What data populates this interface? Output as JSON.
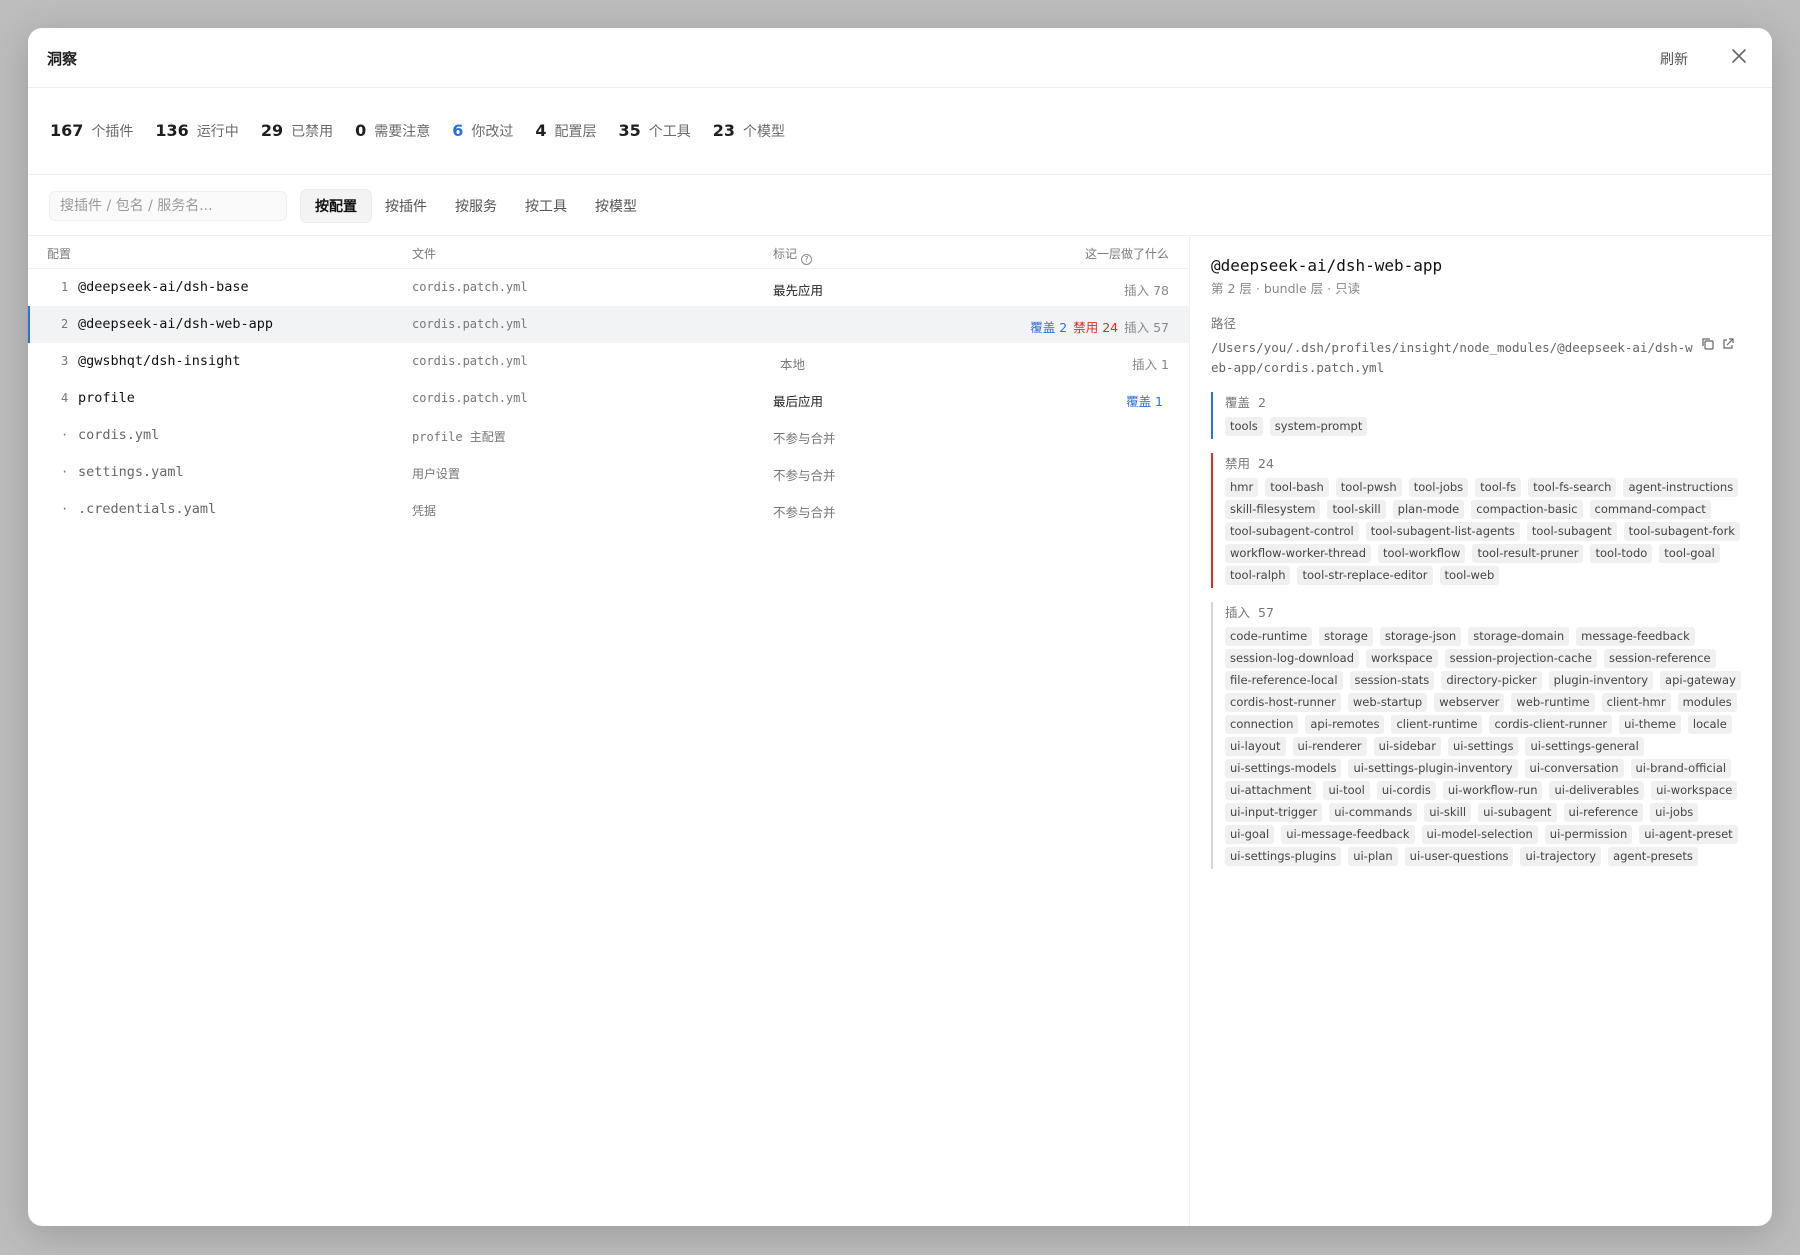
{
  "header": {
    "title": "洞察",
    "refresh": "刷新"
  },
  "stats": [
    {
      "num": "167",
      "label": "个插件"
    },
    {
      "num": "136",
      "label": "运行中"
    },
    {
      "num": "29",
      "label": "已禁用"
    },
    {
      "num": "0",
      "label": "需要注意"
    },
    {
      "num": "6",
      "label": "你改过"
    },
    {
      "num": "4",
      "label": "配置层"
    },
    {
      "num": "35",
      "label": "个工具"
    },
    {
      "num": "23",
      "label": "个模型"
    }
  ],
  "search": {
    "placeholder": "搜插件 / 包名 / 服务名..."
  },
  "tabs": [
    "按配置",
    "按插件",
    "按服务",
    "按工具",
    "按模型"
  ],
  "table": {
    "columns": {
      "config": "配置",
      "file": "文件",
      "mark": "标记",
      "what": "这一层做了什么"
    },
    "rows": [
      {
        "idx": "1",
        "name": "@deepseek-ai/dsh-base",
        "file": "cordis.patch.yml",
        "mark": "最先应用",
        "what": "插入 78"
      },
      {
        "idx": "2",
        "name": "@deepseek-ai/dsh-web-app",
        "file": "cordis.patch.yml",
        "mark": "",
        "ov": "覆盖 2",
        "dis": "禁用 24",
        "what": "插入 57"
      },
      {
        "idx": "3",
        "name": "@gwsbhqt/dsh-insight",
        "file": "cordis.patch.yml",
        "mark": "本地",
        "what": "插入 1"
      },
      {
        "idx": "4",
        "name": "profile",
        "file": "cordis.patch.yml",
        "mark": "最后应用",
        "ov": "覆盖 1"
      },
      {
        "idx": "·",
        "name": "cordis.yml",
        "file": "profile 主配置",
        "mark": "不参与合并"
      },
      {
        "idx": "·",
        "name": "settings.yaml",
        "file": "用户设置",
        "mark": "不参与合并"
      },
      {
        "idx": "·",
        "name": ".credentials.yaml",
        "file": "凭据",
        "mark": "不参与合并"
      }
    ]
  },
  "detail": {
    "title": "@deepseek-ai/dsh-web-app",
    "subtitle": "第 2 层 · bundle 层 · 只读",
    "path_label": "路径",
    "path": "/Users/you/.dsh/profiles/insight/node_modules/@deepseek-ai/dsh-web-app/cordis.patch.yml",
    "override": {
      "label": "覆盖",
      "count": "2",
      "items": [
        "tools",
        "system-prompt"
      ]
    },
    "disabled": {
      "label": "禁用",
      "count": "24",
      "items": [
        "hmr",
        "tool-bash",
        "tool-pwsh",
        "tool-jobs",
        "tool-fs",
        "tool-fs-search",
        "agent-instructions",
        "skill-filesystem",
        "tool-skill",
        "plan-mode",
        "compaction-basic",
        "command-compact",
        "tool-subagent-control",
        "tool-subagent-list-agents",
        "tool-subagent",
        "tool-subagent-fork",
        "workflow-worker-thread",
        "tool-workflow",
        "tool-result-pruner",
        "tool-todo",
        "tool-goal",
        "tool-ralph",
        "tool-str-replace-editor",
        "tool-web"
      ]
    },
    "inserted": {
      "label": "插入",
      "count": "57",
      "items": [
        "code-runtime",
        "storage",
        "storage-json",
        "storage-domain",
        "message-feedback",
        "session-log-download",
        "workspace",
        "session-projection-cache",
        "session-reference",
        "file-reference-local",
        "session-stats",
        "directory-picker",
        "plugin-inventory",
        "api-gateway",
        "cordis-host-runner",
        "web-startup",
        "webserver",
        "web-runtime",
        "client-hmr",
        "modules",
        "connection",
        "api-remotes",
        "client-runtime",
        "cordis-client-runner",
        "ui-theme",
        "locale",
        "ui-layout",
        "ui-renderer",
        "ui-sidebar",
        "ui-settings",
        "ui-settings-general",
        "ui-settings-models",
        "ui-settings-plugin-inventory",
        "ui-conversation",
        "ui-brand-official",
        "ui-attachment",
        "ui-tool",
        "ui-cordis",
        "ui-workflow-run",
        "ui-deliverables",
        "ui-workspace",
        "ui-input-trigger",
        "ui-commands",
        "ui-skill",
        "ui-subagent",
        "ui-reference",
        "ui-jobs",
        "ui-goal",
        "ui-message-feedback",
        "ui-model-selection",
        "ui-permission",
        "ui-agent-preset",
        "ui-settings-plugins",
        "ui-plan",
        "ui-user-questions",
        "ui-trajectory",
        "agent-presets"
      ]
    }
  },
  "colors": {
    "blue": "#2f6fdb",
    "red": "#d93025"
  }
}
